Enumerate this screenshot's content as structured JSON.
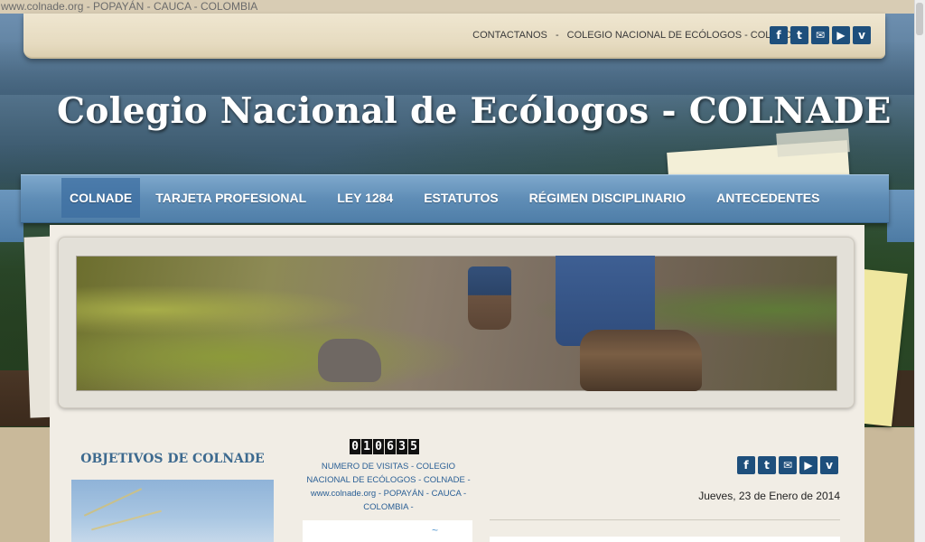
{
  "status_bar": {
    "text": "www.colnade.org - POPAYÁN - CAUCA - COLOMBIA"
  },
  "header": {
    "links": [
      "CONTACTANOS",
      "COLEGIO NACIONAL DE ECÓLOGOS - COLNADE"
    ],
    "link_separator": "-",
    "site_title": "Colegio Nacional de Ecólogos - COLNADE",
    "social_icons": [
      {
        "name": "facebook-icon",
        "glyph": "f"
      },
      {
        "name": "twitter-icon",
        "glyph": "t"
      },
      {
        "name": "email-icon",
        "glyph": "✉"
      },
      {
        "name": "youtube-icon",
        "glyph": "▶"
      },
      {
        "name": "vimeo-icon",
        "glyph": "v"
      }
    ]
  },
  "nav": {
    "items": [
      {
        "label": "COLNADE",
        "active": true
      },
      {
        "label": "TARJETA PROFESIONAL",
        "active": false
      },
      {
        "label": "LEY 1284",
        "active": false
      },
      {
        "label": "ESTATUTOS",
        "active": false
      },
      {
        "label": "RÉGIMEN DISCIPLINARIO",
        "active": false
      },
      {
        "label": "ANTECEDENTES",
        "active": false
      }
    ]
  },
  "left_column": {
    "title": "OBJETIVOS DE COLNADE"
  },
  "center_column": {
    "counter_digits": [
      "0",
      "1",
      "0",
      "6",
      "3",
      "5"
    ],
    "visits_text": "NUMERO DE VISITAS - COLEGIO NACIONAL DE ECÓLOGOS - COLNADE - www.colnade.org - POPAYÁN - CAUCA - COLOMBIA -"
  },
  "right_column": {
    "date": "Jueves, 23 de Enero de 2014"
  },
  "colors": {
    "nav_blue": "#5f8db6",
    "title_blue": "#3d6a8f",
    "social_blue": "#1e4f7c",
    "link_blue": "#2a5f95"
  }
}
